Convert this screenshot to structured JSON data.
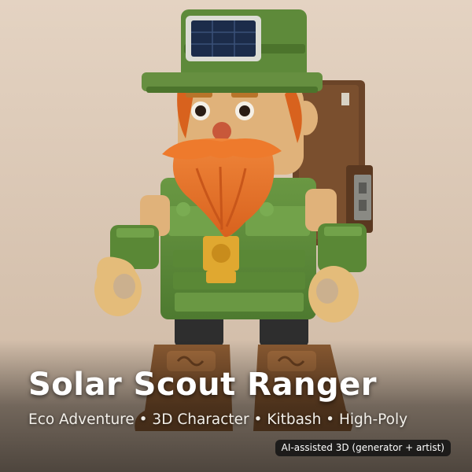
{
  "title": "Solar Scout Ranger",
  "subtitle": "Eco Adventure • 3D Character • Kitbash • High-Poly",
  "badge": "AI-assisted 3D (generator + artist)",
  "colors": {
    "background": "#dcc8b4",
    "hat": "#5e8a3a",
    "beard": "#e8782c",
    "skin": "#e0b27a",
    "body": "#5f8c3a",
    "boots": "#8a5a32",
    "backpack": "#6b4428"
  }
}
